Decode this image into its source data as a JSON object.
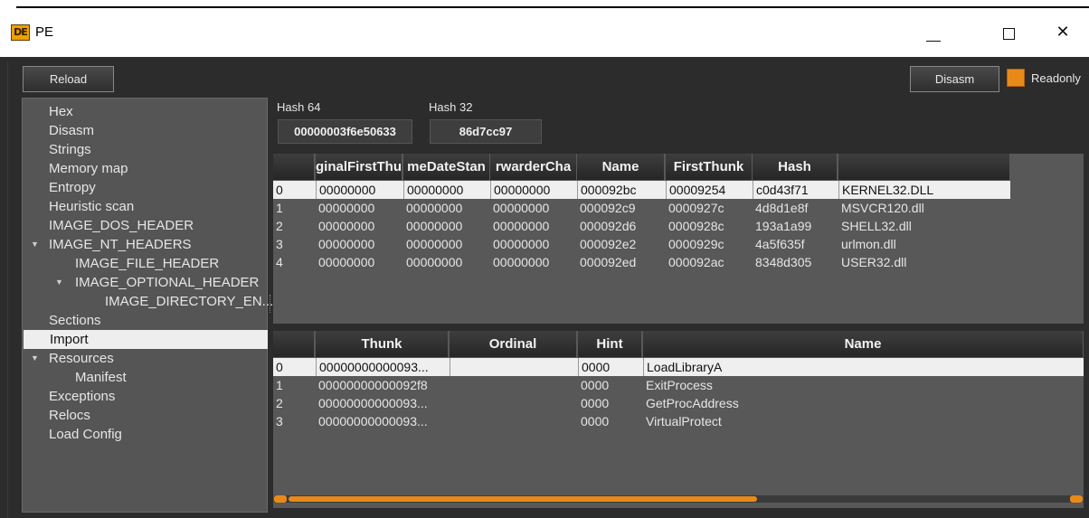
{
  "window": {
    "title": "PE",
    "icon_text": "DE",
    "minimize": "—",
    "maximize": "☐",
    "close": "✕"
  },
  "toolbar": {
    "reload_label": "Reload",
    "disasm_label": "Disasm",
    "readonly_label": "Readonly",
    "readonly_checked": true,
    "accent_color": "#e88a1a"
  },
  "sidebar": {
    "items": [
      {
        "label": "Hex",
        "level": 0
      },
      {
        "label": "Disasm",
        "level": 0
      },
      {
        "label": "Strings",
        "level": 0
      },
      {
        "label": "Memory map",
        "level": 0
      },
      {
        "label": "Entropy",
        "level": 0
      },
      {
        "label": "Heuristic scan",
        "level": 0
      },
      {
        "label": "IMAGE_DOS_HEADER",
        "level": 0
      },
      {
        "label": "IMAGE_NT_HEADERS",
        "level": 0,
        "expanded": true
      },
      {
        "label": "IMAGE_FILE_HEADER",
        "level": 1
      },
      {
        "label": "IMAGE_OPTIONAL_HEADER",
        "level": 1,
        "expanded": true
      },
      {
        "label": "IMAGE_DIRECTORY_EN...",
        "level": 2
      },
      {
        "label": "Sections",
        "level": 0
      },
      {
        "label": "Import",
        "level": 0,
        "selected": true
      },
      {
        "label": "Resources",
        "level": 0,
        "expanded": true
      },
      {
        "label": "Manifest",
        "level": 1
      },
      {
        "label": "Exceptions",
        "level": 0
      },
      {
        "label": "Relocs",
        "level": 0
      },
      {
        "label": "Load Config",
        "level": 0
      }
    ]
  },
  "hashes": {
    "hash64_label": "Hash 64",
    "hash64_value": "00000003f6e50633",
    "hash32_label": "Hash 32",
    "hash32_value": "86d7cc97"
  },
  "imports_table": {
    "headers": [
      "",
      "ginalFirstThu",
      "meDateStan",
      "rwarderCha",
      "Name",
      "FirstThunk",
      "Hash",
      ""
    ],
    "rows": [
      [
        "0",
        "00000000",
        "00000000",
        "00000000",
        "000092bc",
        "00009254",
        "c0d43f71",
        "KERNEL32.DLL"
      ],
      [
        "1",
        "00000000",
        "00000000",
        "00000000",
        "000092c9",
        "0000927c",
        "4d8d1e8f",
        "MSVCR120.dll"
      ],
      [
        "2",
        "00000000",
        "00000000",
        "00000000",
        "000092d6",
        "0000928c",
        "193a1a99",
        "SHELL32.dll"
      ],
      [
        "3",
        "00000000",
        "00000000",
        "00000000",
        "000092e2",
        "0000929c",
        "4a5f635f",
        "urlmon.dll"
      ],
      [
        "4",
        "00000000",
        "00000000",
        "00000000",
        "000092ed",
        "000092ac",
        "8348d305",
        "USER32.dll"
      ]
    ],
    "selected_row": 0
  },
  "functions_table": {
    "headers": [
      "",
      "Thunk",
      "Ordinal",
      "Hint",
      "Name"
    ],
    "rows": [
      [
        "0",
        "00000000000093...",
        "",
        "0000",
        "LoadLibraryA"
      ],
      [
        "1",
        "00000000000092f8",
        "",
        "0000",
        "ExitProcess"
      ],
      [
        "2",
        "00000000000093...",
        "",
        "0000",
        "GetProcAddress"
      ],
      [
        "3",
        "00000000000093...",
        "",
        "0000",
        "VirtualProtect"
      ]
    ],
    "selected_row": 0
  }
}
